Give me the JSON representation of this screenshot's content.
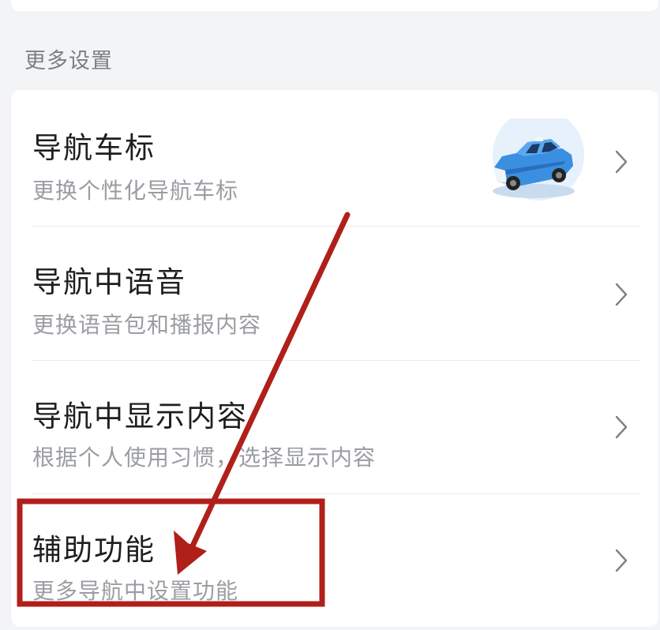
{
  "section": {
    "title": "更多设置"
  },
  "settings": [
    {
      "title": "导航车标",
      "subtitle": "更换个性化导航车标"
    },
    {
      "title": "导航中语音",
      "subtitle": "更换语音包和播报内容"
    },
    {
      "title": "导航中显示内容",
      "subtitle": "根据个人使用习惯，选择显示内容"
    },
    {
      "title": "辅助功能",
      "subtitle": "更多导航中设置功能"
    }
  ],
  "icons": {
    "chevron": "chevron-right-icon",
    "car": "car-icon"
  },
  "colors": {
    "background": "#f3f4f6",
    "card": "#ffffff",
    "title_text": "#1d1e20",
    "subtitle_text": "#9a9da2",
    "annotation": "#b01f1a",
    "car_body": "#3a8fe0"
  }
}
